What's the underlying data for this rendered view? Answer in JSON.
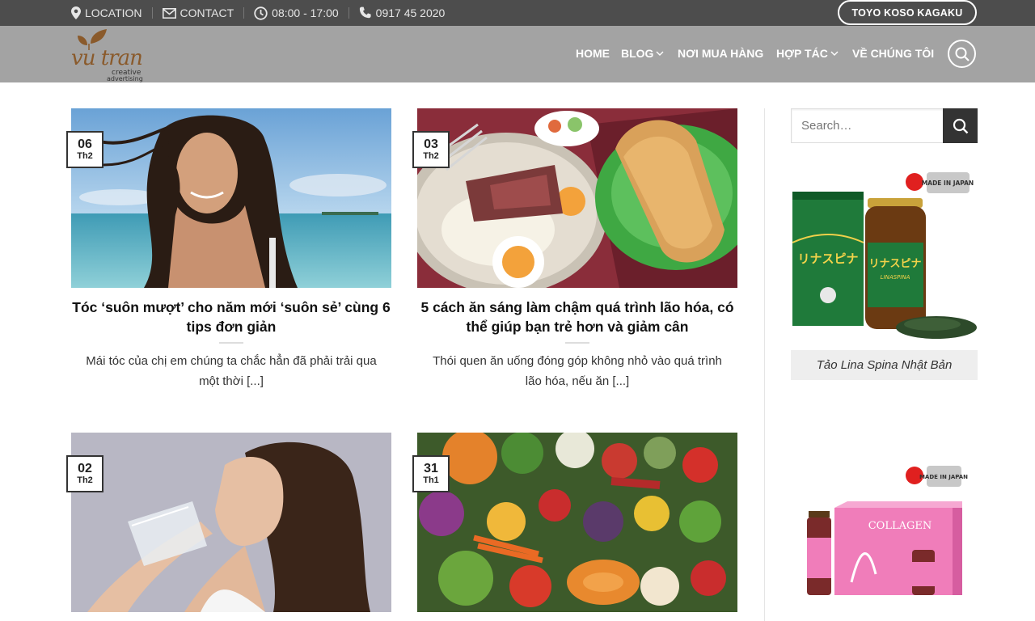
{
  "topbar": {
    "location": "LOCATION",
    "contact": "CONTACT",
    "hours": "08:00 - 17:00",
    "phone": "0917 45 2020",
    "cta": "TOYO KOSO KAGAKU"
  },
  "logo": {
    "brand": "vu tran",
    "tagline1": "creative",
    "tagline2": "advertising"
  },
  "nav": {
    "items": [
      {
        "label": "HOME"
      },
      {
        "label": "BLOG"
      },
      {
        "label": "NƠI MUA HÀNG"
      },
      {
        "label": "HỢP TÁC"
      },
      {
        "label": "VỀ CHÚNG TÔI"
      }
    ]
  },
  "posts": [
    {
      "day": "06",
      "month": "Th2",
      "title": "Tóc ‘suôn mượt’ cho năm mới ‘suôn sẻ’ cùng 6 tips đơn giản",
      "excerpt": "Mái tóc của chị em chúng ta chắc hẳn đã phải trải qua một thời [...]"
    },
    {
      "day": "03",
      "month": "Th2",
      "title": "5 cách ăn sáng làm chậm quá trình lão hóa, có thể giúp bạn trẻ hơn và giảm cân",
      "excerpt": "Thói quen ăn uống đóng góp không nhỏ vào quá trình lão hóa, nếu ăn [...]"
    },
    {
      "day": "02",
      "month": "Th2",
      "title": "",
      "excerpt": ""
    },
    {
      "day": "31",
      "month": "Th1",
      "title": "",
      "excerpt": ""
    }
  ],
  "sidebar": {
    "search_placeholder": "Search…",
    "product1": {
      "badge": "MADE IN JAPAN",
      "label": "リナスピナ",
      "sublabel": "LINASPINA",
      "caption": "Tảo Lina Spina Nhật Bản"
    },
    "product2": {
      "badge": "MADE IN JAPAN",
      "label": "COLLAGEN"
    }
  },
  "colors": {
    "topbar": "#4d4d4d",
    "header": "#a3a3a3",
    "accent_dark": "#333333",
    "logo_brown": "#8a5a2b"
  }
}
